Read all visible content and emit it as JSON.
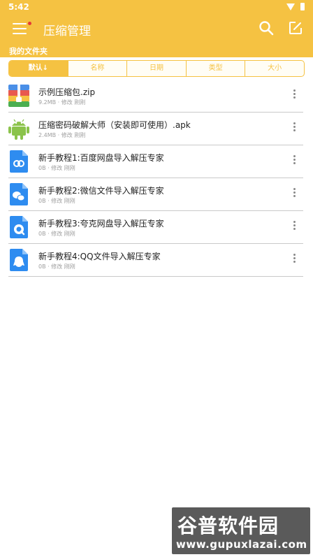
{
  "status_bar": {
    "time": "5:42"
  },
  "app_bar": {
    "title": "压缩管理"
  },
  "section": {
    "title": "我的文件夹"
  },
  "sort_tabs": [
    {
      "label": "默认↓",
      "active": true
    },
    {
      "label": "名称",
      "active": false
    },
    {
      "label": "日期",
      "active": false
    },
    {
      "label": "类型",
      "active": false
    },
    {
      "label": "大小",
      "active": false
    }
  ],
  "files": [
    {
      "name": "示例压缩包.zip",
      "meta": "9.2MB · 修改 刚刚",
      "icon": "zip-archive-icon"
    },
    {
      "name": "压缩密码破解大师（安装即可使用）.apk",
      "meta": "2.4MB · 修改 刚刚",
      "icon": "android-icon"
    },
    {
      "name": "新手教程1:百度网盘导入解压专家",
      "meta": "0B · 修改 刚刚",
      "icon": "baidu-netdisk-doc-icon"
    },
    {
      "name": "新手教程2:微信文件导入解压专家",
      "meta": "0B · 修改 刚刚",
      "icon": "wechat-doc-icon"
    },
    {
      "name": "新手教程3:夸克网盘导入解压专家",
      "meta": "0B · 修改 刚刚",
      "icon": "quark-doc-icon"
    },
    {
      "name": "新手教程4:QQ文件导入解压专家",
      "meta": "0B · 修改 刚刚",
      "icon": "qq-doc-icon"
    }
  ],
  "watermark": {
    "title": "谷普软件园",
    "url": "www.gupuxlazai.com"
  },
  "colors": {
    "accent": "#f5c242",
    "divider": "#c9c9c9",
    "meta_text": "#9e9e9e"
  }
}
